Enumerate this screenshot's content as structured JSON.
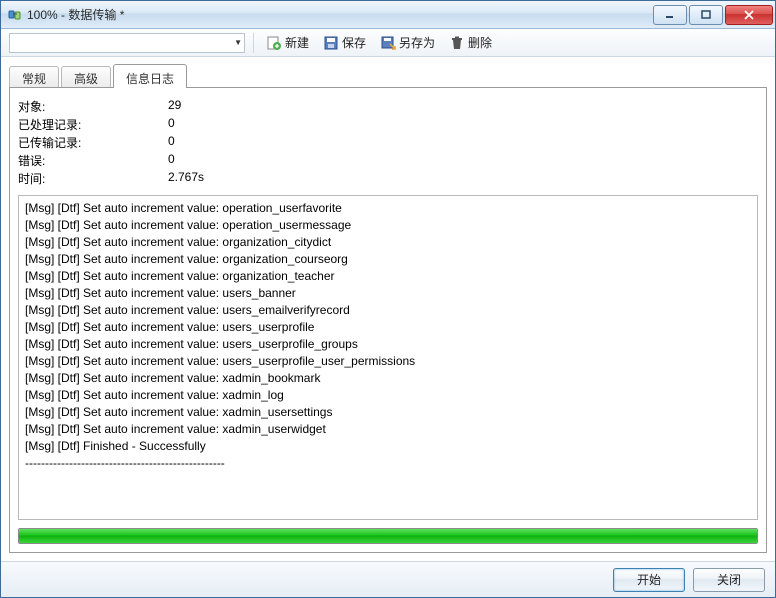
{
  "title": "100% - 数据传输 *",
  "toolbar": {
    "new_label": "新建",
    "save_label": "保存",
    "saveas_label": "另存为",
    "delete_label": "删除"
  },
  "tabs": {
    "general": "常规",
    "advanced": "高级",
    "log": "信息日志"
  },
  "stats": {
    "labels": {
      "object": "对象:",
      "processed": "已处理记录:",
      "transferred": "已传输记录:",
      "errors": "错误:",
      "time": "时间:"
    },
    "values": {
      "object": "29",
      "processed": "0",
      "transferred": "0",
      "errors": "0",
      "time": "2.767s"
    }
  },
  "log_lines": [
    "[Msg] [Dtf] Set auto increment value: operation_userfavorite",
    "[Msg] [Dtf] Set auto increment value: operation_usermessage",
    "[Msg] [Dtf] Set auto increment value: organization_citydict",
    "[Msg] [Dtf] Set auto increment value: organization_courseorg",
    "[Msg] [Dtf] Set auto increment value: organization_teacher",
    "[Msg] [Dtf] Set auto increment value: users_banner",
    "[Msg] [Dtf] Set auto increment value: users_emailverifyrecord",
    "[Msg] [Dtf] Set auto increment value: users_userprofile",
    "[Msg] [Dtf] Set auto increment value: users_userprofile_groups",
    "[Msg] [Dtf] Set auto increment value: users_userprofile_user_permissions",
    "[Msg] [Dtf] Set auto increment value: xadmin_bookmark",
    "[Msg] [Dtf] Set auto increment value: xadmin_log",
    "[Msg] [Dtf] Set auto increment value: xadmin_usersettings",
    "[Msg] [Dtf] Set auto increment value: xadmin_userwidget",
    "[Msg] [Dtf] Finished - Successfully",
    "--------------------------------------------------"
  ],
  "footer": {
    "start": "开始",
    "close": "关闭"
  },
  "progress_percent": 100
}
